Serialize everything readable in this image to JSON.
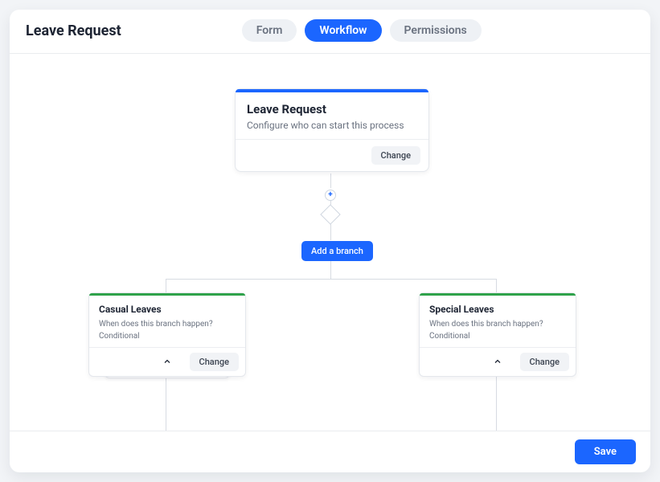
{
  "page": {
    "title": "Leave Request"
  },
  "tabs": {
    "form": "Form",
    "workflow": "Workflow",
    "permissions": "Permissions",
    "active": "workflow"
  },
  "start_node": {
    "title": "Leave Request",
    "subtitle": "Configure who can start this process",
    "change_label": "Change",
    "accent_color": "#1b66ff"
  },
  "add_branch_label": "Add a branch",
  "branches": [
    {
      "title": "Casual Leaves",
      "question": "When does this branch happen?",
      "type": "Conditional",
      "change_label": "Change",
      "accent_color": "#2fa24a"
    },
    {
      "title": "Special Leaves",
      "question": "When does this branch happen?",
      "type": "Conditional",
      "change_label": "Change",
      "accent_color": "#2fa24a"
    }
  ],
  "footer": {
    "save_label": "Save"
  }
}
